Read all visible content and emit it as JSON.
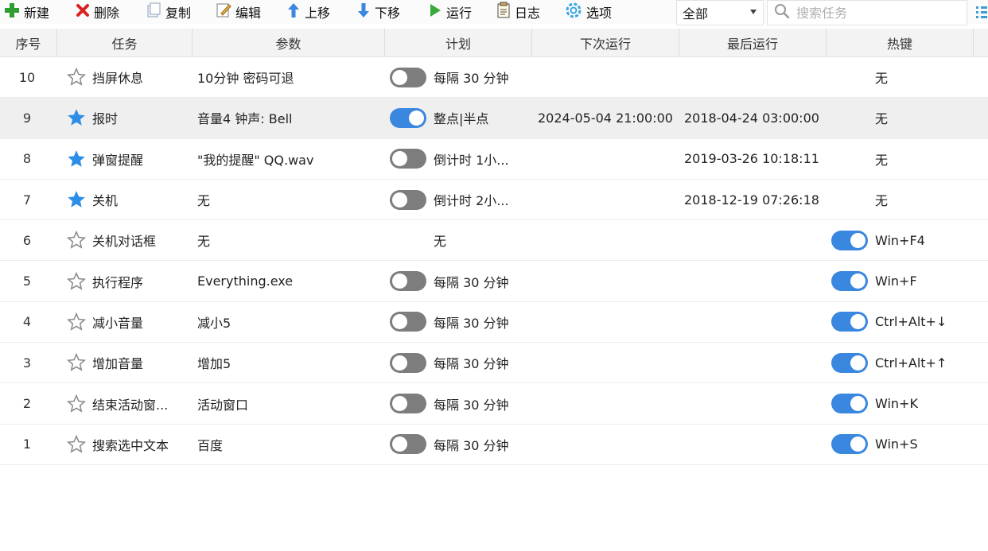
{
  "toolbar": {
    "new": "新建",
    "delete": "删除",
    "copy": "复制",
    "edit": "编辑",
    "move_up": "上移",
    "move_down": "下移",
    "run": "运行",
    "log": "日志",
    "options": "选项"
  },
  "filter": {
    "selected": "全部"
  },
  "search": {
    "placeholder": "搜索任务"
  },
  "columns": {
    "num": "序号",
    "task": "任务",
    "param": "参数",
    "schedule": "计划",
    "next_run": "下次运行",
    "last_run": "最后运行",
    "hotkey": "热键"
  },
  "colors": {
    "accent": "#3a87e0",
    "toggle_off": "#7d7d7d",
    "star": "#2d8ee8"
  },
  "rows": [
    {
      "num": "10",
      "starred": false,
      "name": "挡屏休息",
      "param": "10分钟 密码可退",
      "schedule_toggle": "off",
      "schedule": "每隔 30 分钟",
      "next_run": "",
      "last_run": "",
      "hotkey_toggle": "none",
      "hotkey": "无"
    },
    {
      "num": "9",
      "starred": true,
      "name": "报时",
      "param": "音量4 钟声: Bell",
      "schedule_toggle": "on",
      "schedule": "整点|半点",
      "next_run": "2024-05-04 21:00:00",
      "last_run": "2018-04-24 03:00:00",
      "hotkey_toggle": "none",
      "hotkey": "无"
    },
    {
      "num": "8",
      "starred": true,
      "name": "弹窗提醒",
      "param": "\"我的提醒\" QQ.wav",
      "schedule_toggle": "off",
      "schedule": "倒计时 1小...",
      "next_run": "",
      "last_run": "2019-03-26 10:18:11",
      "hotkey_toggle": "none",
      "hotkey": "无"
    },
    {
      "num": "7",
      "starred": true,
      "name": "关机",
      "param": "无",
      "schedule_toggle": "off",
      "schedule": "倒计时 2小...",
      "next_run": "",
      "last_run": "2018-12-19 07:26:18",
      "hotkey_toggle": "none",
      "hotkey": "无"
    },
    {
      "num": "6",
      "starred": false,
      "name": "关机对话框",
      "param": "无",
      "schedule_toggle": "none",
      "schedule": "无",
      "next_run": "",
      "last_run": "",
      "hotkey_toggle": "on",
      "hotkey": "Win+F4"
    },
    {
      "num": "5",
      "starred": false,
      "name": "执行程序",
      "param": "Everything.exe",
      "schedule_toggle": "off",
      "schedule": "每隔 30 分钟",
      "next_run": "",
      "last_run": "",
      "hotkey_toggle": "on",
      "hotkey": "Win+F"
    },
    {
      "num": "4",
      "starred": false,
      "name": "减小音量",
      "param": "减小5",
      "schedule_toggle": "off",
      "schedule": "每隔 30 分钟",
      "next_run": "",
      "last_run": "",
      "hotkey_toggle": "on",
      "hotkey": "Ctrl+Alt+↓"
    },
    {
      "num": "3",
      "starred": false,
      "name": "增加音量",
      "param": "增加5",
      "schedule_toggle": "off",
      "schedule": "每隔 30 分钟",
      "next_run": "",
      "last_run": "",
      "hotkey_toggle": "on",
      "hotkey": "Ctrl+Alt+↑"
    },
    {
      "num": "2",
      "starred": false,
      "name": "结束活动窗...",
      "param": "活动窗口",
      "schedule_toggle": "off",
      "schedule": "每隔 30 分钟",
      "next_run": "",
      "last_run": "",
      "hotkey_toggle": "on",
      "hotkey": "Win+K"
    },
    {
      "num": "1",
      "starred": false,
      "name": "搜索选中文本",
      "param": "百度",
      "schedule_toggle": "off",
      "schedule": "每隔 30 分钟",
      "next_run": "",
      "last_run": "",
      "hotkey_toggle": "on",
      "hotkey": "Win+S"
    }
  ]
}
